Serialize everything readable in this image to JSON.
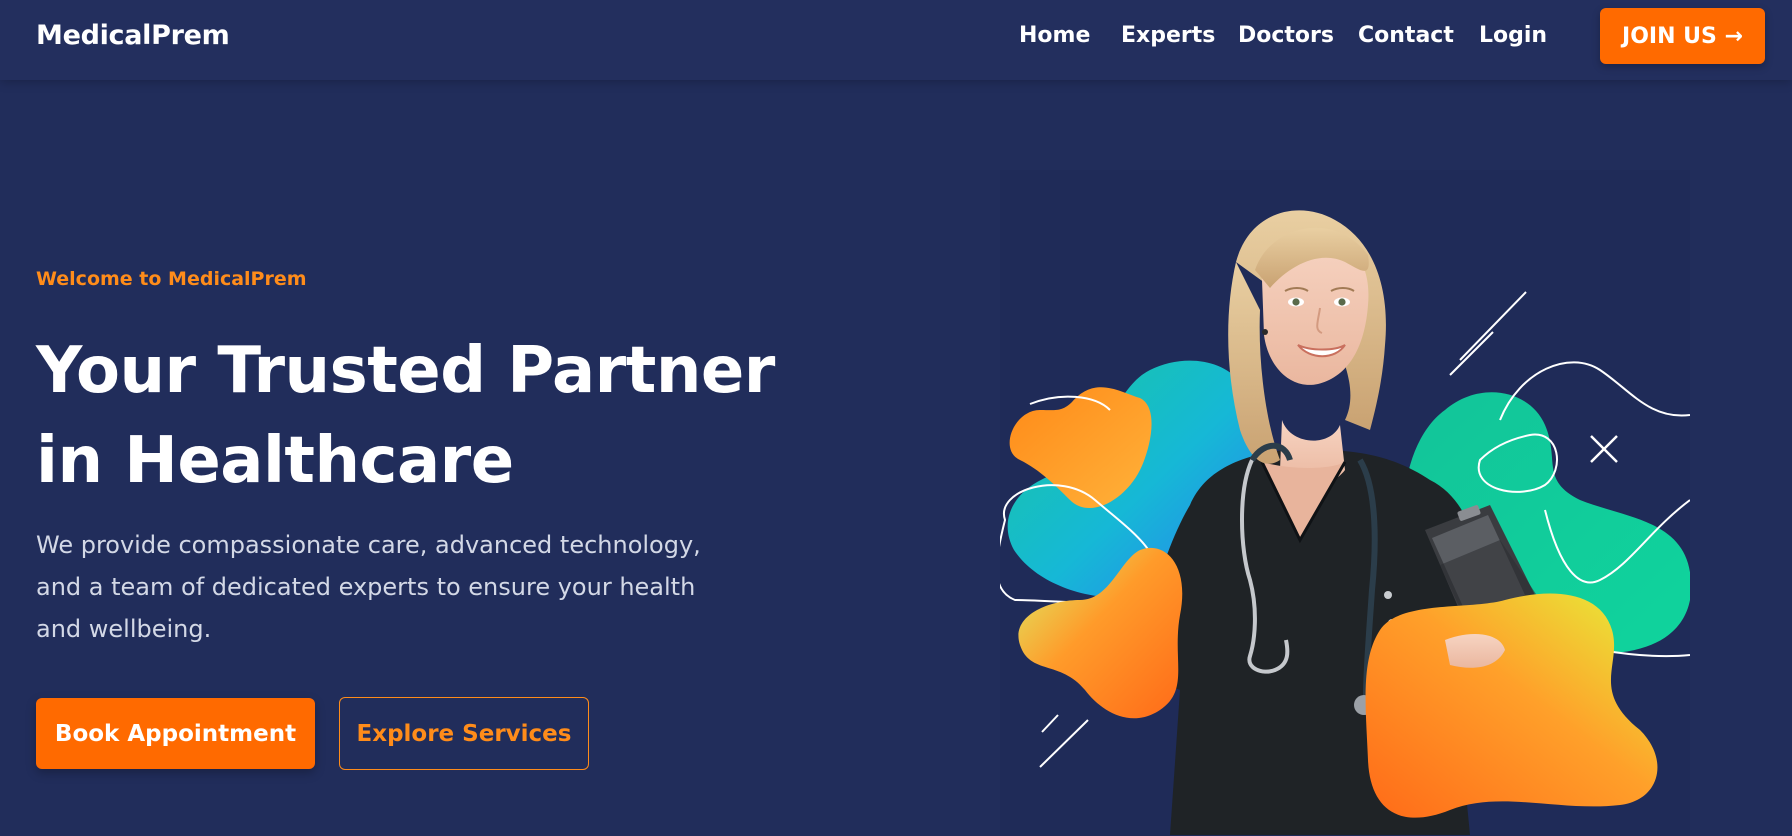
{
  "header": {
    "brand": "MedicalPrem",
    "nav": [
      {
        "label": "Home"
      },
      {
        "label": "Experts"
      },
      {
        "label": "Doctors"
      },
      {
        "label": "Contact"
      },
      {
        "label": "Login"
      }
    ],
    "cta_label": "JOIN US →"
  },
  "hero": {
    "eyebrow": "Welcome to MedicalPrem",
    "title_line1": "Your Trusted Partner",
    "title_line2": "in Healthcare",
    "subtitle": "We provide compassionate care, advanced technology, and a team of dedicated experts to ensure your health and wellbeing.",
    "primary_button": "Book Appointment",
    "secondary_button": "Explore Services"
  },
  "colors": {
    "background": "#212d5b",
    "accent": "#ff6a00",
    "accent_text": "#ff8c1a",
    "body_text": "#d3d8e6"
  }
}
